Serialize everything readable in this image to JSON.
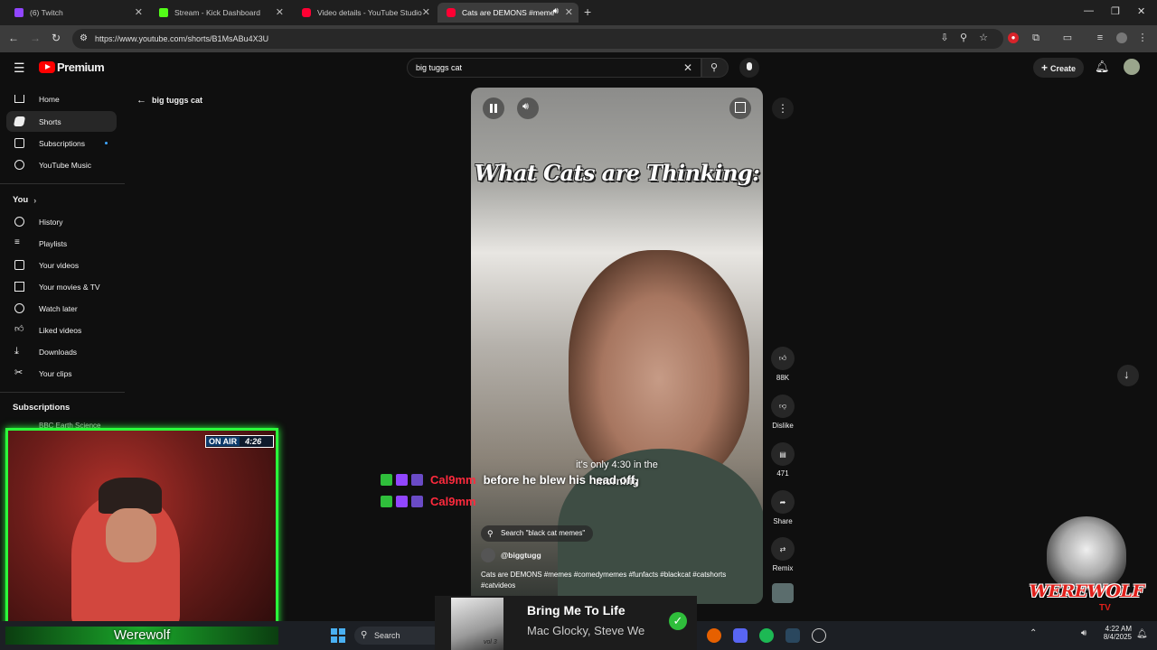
{
  "browser": {
    "tabs": [
      {
        "label": "(6) Twitch",
        "color": "#9146ff"
      },
      {
        "label": "Stream - Kick Dashboard",
        "color": "#53fc18"
      },
      {
        "label": "Video details - YouTube Studio",
        "color": "#ff0033"
      },
      {
        "label": "Cats are DEMONS #meme",
        "color": "#ff0033"
      }
    ],
    "url": "https://www.youtube.com/shorts/B1MsABu4X3U"
  },
  "header": {
    "logo": "Premium",
    "search_value": "big tuggs cat",
    "create_label": "Create"
  },
  "sidebar": {
    "main": [
      "Home",
      "Shorts",
      "Subscriptions",
      "YouTube Music"
    ],
    "you_label": "You",
    "you_items": [
      "History",
      "Playlists",
      "Your videos",
      "Your movies & TV",
      "Watch later",
      "Liked videos",
      "Downloads",
      "Your clips"
    ],
    "subscriptions_label": "Subscriptions",
    "subscriptions_first": "BBC Earth Science"
  },
  "shorts": {
    "back_label": "big tuggs cat",
    "video_title_overlay": "What Cats are Thinking:",
    "caption_top": "it's only 4:30 in the",
    "caption_bottom": "morning",
    "caption_overlay": "before he blew his head off,",
    "search_chip": "Search \"black cat memes\"",
    "channel": "@biggtugg",
    "description_line1": "Cats are DEMONS #memes #comedymemes #funfacts #blackcat #catshorts",
    "description_line2": "#catvideos",
    "actions": {
      "likes": "88K",
      "dislike": "Dislike",
      "comments": "471",
      "share": "Share",
      "remix": "Remix"
    }
  },
  "stream_overlay": {
    "chat_user": "Cal9mm",
    "chat_user_color": "#ff2a3d",
    "webcam_label": "Werewolf",
    "on_air": "ON AIR",
    "on_air_time": "4:26",
    "logo_text": "WEREWOLF",
    "logo_sub": "TV",
    "accent": "#2bff3b"
  },
  "music": {
    "title": "Bring Me To Life",
    "artist": "Mac Glocky, Steve We",
    "album_tag": "vol 3"
  },
  "taskbar": {
    "search_label": "Search",
    "time": "4:22 AM",
    "date": "8/4/2025"
  }
}
